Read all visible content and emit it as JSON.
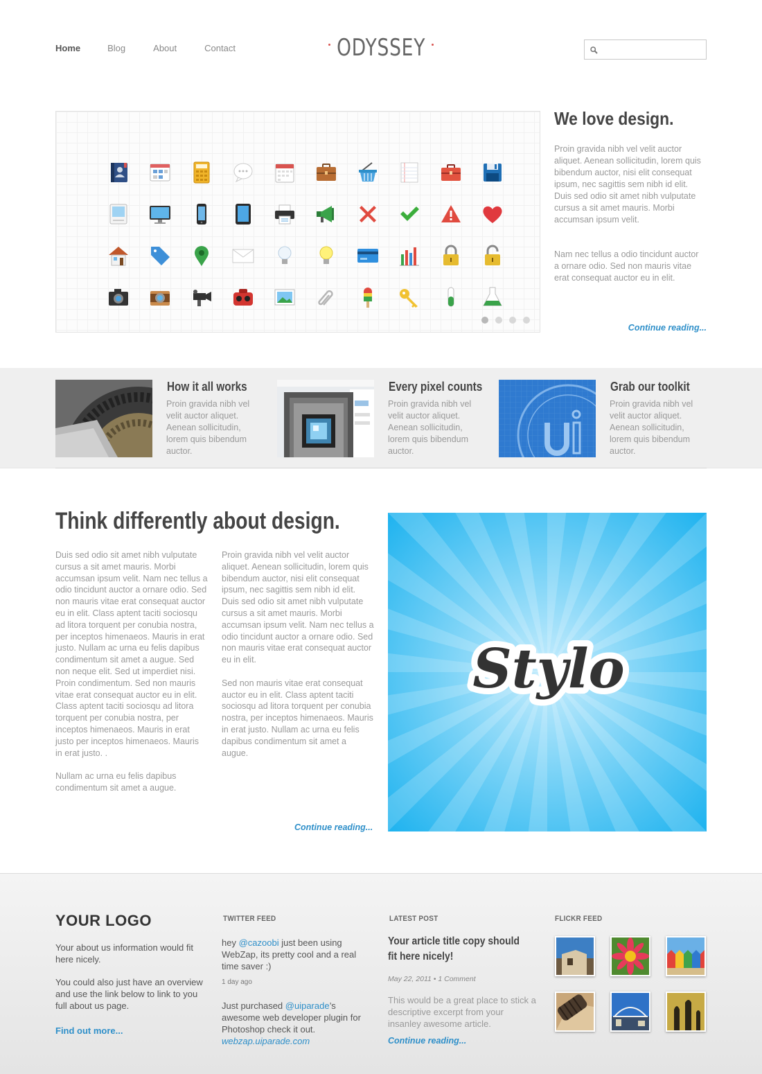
{
  "nav": {
    "items": [
      {
        "label": "Home",
        "active": true
      },
      {
        "label": "Blog",
        "active": false
      },
      {
        "label": "About",
        "active": false
      },
      {
        "label": "Contact",
        "active": false
      }
    ]
  },
  "brand": {
    "name": "ODYSSEY",
    "accent_dot_color": "#d9534f"
  },
  "search": {
    "value": "",
    "placeholder": "",
    "icon": "search-icon"
  },
  "slider": {
    "icons": [
      "address-book-icon",
      "window-icon",
      "calculator-icon",
      "speech-bubble-icon",
      "calendar-icon",
      "briefcase-icon",
      "shopping-basket-icon",
      "notepad-icon",
      "toolbox-icon",
      "floppy-disk-icon",
      "computer-classic-icon",
      "monitor-icon",
      "phone-icon",
      "tablet-icon",
      "printer-icon",
      "megaphone-icon",
      "cross-icon",
      "checkmark-icon",
      "warning-icon",
      "heart-icon",
      "house-icon",
      "tag-icon",
      "map-pin-icon",
      "envelope-icon",
      "lightbulb-off-icon",
      "lightbulb-on-icon",
      "credit-card-icon",
      "bar-chart-icon",
      "padlock-locked-icon",
      "padlock-open-icon",
      "camera-icon",
      "retro-camera-icon",
      "movie-camera-icon",
      "viewmaster-icon",
      "picture-icon",
      "paperclip-icon",
      "ice-lolly-icon",
      "key-icon",
      "test-tube-icon",
      "flask-icon"
    ],
    "pages": 4,
    "active_page": 1
  },
  "intro": {
    "title": "We love design.",
    "paragraph1": "Proin gravida nibh vel velit auctor aliquet. Aenean sollicitudin, lorem quis bibendum auctor, nisi elit consequat ipsum, nec sagittis sem nibh id elit. Duis sed odio sit amet nibh vulputate cursus a sit amet mauris. Morbi accumsan ipsum velit.",
    "paragraph2": "Nam nec tellus a odio tincidunt auctor a ornare odio. Sed non mauris vitae erat consequat auctor eu in elit.",
    "continue_label": "Continue reading..."
  },
  "features": [
    {
      "title": "How it all works",
      "text": "Proin gravida nibh vel velit auctor aliquet. Aenean sollicitudin, lorem quis bibendum auctor.",
      "thumb": "gears-thumb"
    },
    {
      "title": "Every pixel counts",
      "text": "Proin gravida nibh vel velit auctor aliquet. Aenean sollicitudin, lorem quis bibendum auctor.",
      "thumb": "pixel-camera-thumb"
    },
    {
      "title": "Grab our toolkit",
      "text": "Proin gravida nibh vel velit auctor aliquet. Aenean sollicitudin, lorem quis bibendum auctor.",
      "thumb": "ui-blueprint-thumb"
    }
  ],
  "article": {
    "title": "Think differently about design.",
    "col1_p1": "Duis sed odio sit amet nibh vulputate cursus a sit amet mauris. Morbi accumsan ipsum velit. Nam nec tellus a odio tincidunt auctor a ornare odio. Sed non  mauris vitae erat consequat auctor eu in elit. Class aptent taciti sociosqu ad litora torquent per conubia nostra, per inceptos himenaeos. Mauris in erat justo. Nullam ac urna eu felis dapibus condimentum sit amet a augue. Sed non neque elit. Sed ut imperdiet nisi. Proin condimentum. Sed non  mauris vitae erat consequat auctor eu in elit. Class aptent taciti sociosqu ad litora torquent per conubia nostra, per inceptos himenaeos. Mauris in erat justo per inceptos himenaeos. Mauris in erat justo. .",
    "col1_p2": "Nullam ac urna eu felis dapibus condimentum sit amet a augue.",
    "col2_p1": "Proin gravida nibh vel velit auctor aliquet. Aenean sollicitudin, lorem quis bibendum auctor, nisi elit consequat ipsum, nec sagittis sem nibh id elit. Duis sed odio sit amet nibh vulputate cursus a sit amet mauris. Morbi accumsan ipsum velit. Nam nec tellus a odio tincidunt auctor a ornare odio. Sed non mauris vitae erat consequat auctor eu in elit.",
    "col2_p2": "Sed non  mauris vitae erat consequat auctor eu in elit. Class aptent taciti sociosqu ad litora torquent per conubia nostra, per inceptos himenaeos. Mauris in erat justo. Nullam ac urna eu felis dapibus condimentum sit amet a augue.",
    "continue_label": "Continue reading...",
    "image_text": "Stylo",
    "image_colors": {
      "center": "#bfeafc",
      "edge": "#1fb3ef"
    }
  },
  "footer": {
    "logo": "YOUR LOGO",
    "about_p1": "Your about us information would fit here nicely.",
    "about_p2": "You could also just have an overview and use the link below to link to you full about us page.",
    "find_out_more": "Find out more...",
    "twitter": {
      "heading": "TWITTER FEED",
      "t1_pre": "hey ",
      "t1_handle": "@cazoobi",
      "t1_post": " just been using WebZap, its pretty cool and a real time saver :)",
      "t1_time": "1 day ago",
      "t2_pre": "Just purchased ",
      "t2_handle": "@uiparade",
      "t2_post": "’s awesome web developer plugin for Photoshop check it out.",
      "t2_link": "webzap.uiparade.com"
    },
    "latest_post": {
      "heading": "LATEST POST",
      "title": "Your article title copy should fit here nicely!",
      "meta": "May 22, 2011 • 1 Comment",
      "excerpt": "This would be a great place to stick a descriptive excerpt from your insanley awesome article.",
      "continue_label": "Continue reading..."
    },
    "flickr": {
      "heading": "FLICKR FEED",
      "photos": [
        "building-photo",
        "gerbera-flower-photo",
        "beach-huts-photo",
        "tyre-photo",
        "bridge-photo",
        "shadow-photo"
      ]
    }
  }
}
